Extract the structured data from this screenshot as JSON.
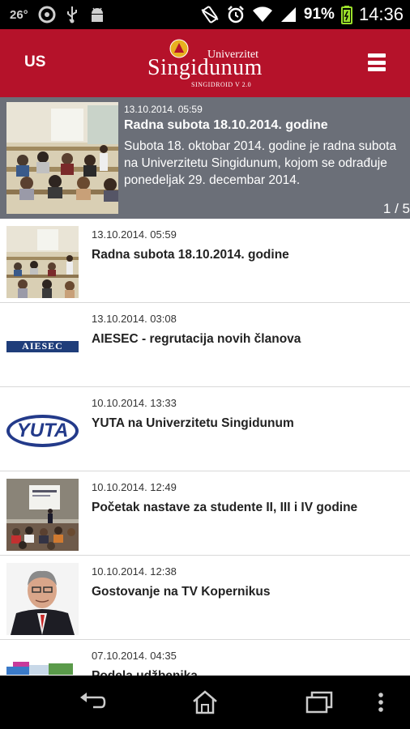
{
  "status_bar": {
    "temperature": "26°",
    "battery_percent": "91%",
    "time": "14:36",
    "icons": [
      "notification-circle-icon",
      "usb-icon",
      "android-icon",
      "vibrate-icon",
      "alarm-icon",
      "wifi-icon",
      "signal-icon",
      "battery-icon"
    ]
  },
  "header": {
    "language": "US",
    "logo_top": "Univerzitet",
    "logo_main": "Singidunum",
    "logo_sub": "SINGIDROID V 2.0",
    "menu_icon": "hamburger-menu-icon",
    "color": "#b5122a"
  },
  "featured": {
    "date": "13.10.2014. 05:59",
    "title": "Radna subota 18.10.2014. godine",
    "text": "Subota 18. oktobar 2014. godine je radna subota na Univerzitetu Singidunum, kojom se odrađuje ponedeljak 29. decembar 2014.",
    "pager": "1 / 5"
  },
  "news": [
    {
      "date": "13.10.2014. 05:59",
      "title": "Radna subota 18.10.2014. godine",
      "thumb": "classroom"
    },
    {
      "date": "13.10.2014. 03:08",
      "title": "AIESEC - regrutacija novih članova",
      "thumb": "aiesec",
      "thumb_text": "AIESEC"
    },
    {
      "date": "10.10.2014. 13:33",
      "title": "YUTA na Univerzitetu Singidunum",
      "thumb": "yuta",
      "thumb_text": "YUTA"
    },
    {
      "date": "10.10.2014. 12:49",
      "title": "Početak nastave za studente II, III i IV godine",
      "thumb": "lecture"
    },
    {
      "date": "10.10.2014. 12:38",
      "title": "Gostovanje na TV Kopernikus",
      "thumb": "portrait"
    },
    {
      "date": "07.10.2014. 04:35",
      "title": "Podela udžbenika",
      "thumb": "books"
    }
  ],
  "nav": {
    "icons": [
      "back-icon",
      "home-icon",
      "recent-apps-icon",
      "overflow-menu-icon"
    ]
  }
}
